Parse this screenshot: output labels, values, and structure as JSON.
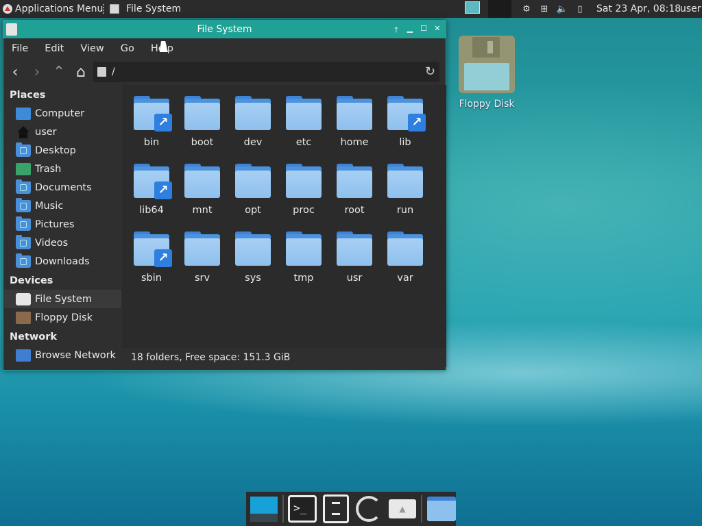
{
  "top_panel": {
    "applications_menu": "Applications Menu",
    "task_title": "File System",
    "clock": "Sat 23 Apr, 08:18",
    "user": "user"
  },
  "window": {
    "title": "File System",
    "menu": [
      "File",
      "Edit",
      "View",
      "Go",
      "Help"
    ],
    "location": "/"
  },
  "sidebar": {
    "places_header": "Places",
    "places": [
      "Computer",
      "user",
      "Desktop",
      "Trash",
      "Documents",
      "Music",
      "Pictures",
      "Videos",
      "Downloads"
    ],
    "devices_header": "Devices",
    "devices": [
      "File System",
      "Floppy Disk"
    ],
    "network_header": "Network",
    "network": [
      "Browse Network"
    ]
  },
  "folders": [
    {
      "name": "bin",
      "link": true
    },
    {
      "name": "boot",
      "link": false
    },
    {
      "name": "dev",
      "link": false
    },
    {
      "name": "etc",
      "link": false
    },
    {
      "name": "home",
      "link": false
    },
    {
      "name": "lib",
      "link": true
    },
    {
      "name": "lib64",
      "link": true
    },
    {
      "name": "mnt",
      "link": false
    },
    {
      "name": "opt",
      "link": false
    },
    {
      "name": "proc",
      "link": false
    },
    {
      "name": "root",
      "link": false
    },
    {
      "name": "run",
      "link": false
    },
    {
      "name": "sbin",
      "link": true
    },
    {
      "name": "srv",
      "link": false
    },
    {
      "name": "sys",
      "link": false
    },
    {
      "name": "tmp",
      "link": false
    },
    {
      "name": "usr",
      "link": false
    },
    {
      "name": "var",
      "link": false
    }
  ],
  "status": "18 folders, Free space: 151.3 GiB",
  "desktop": {
    "floppy_label": "Floppy Disk"
  },
  "colors": {
    "titlebar": "#1fa195",
    "folder": "#8ec0ee",
    "link_badge": "#2f7fe0"
  }
}
